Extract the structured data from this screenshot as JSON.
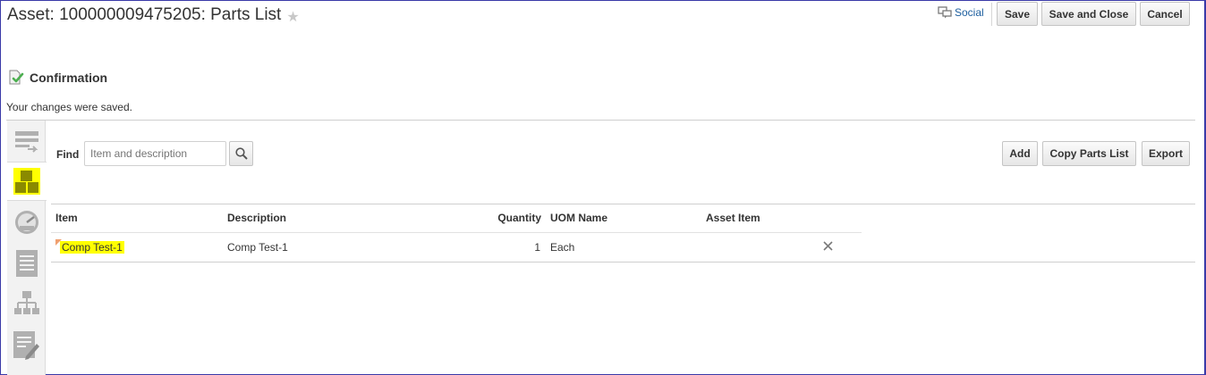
{
  "header": {
    "title": "Asset: 100000009475205:  Parts List",
    "social_label": "Social",
    "save_label": "Save",
    "save_close_label": "Save and Close",
    "cancel_label": "Cancel"
  },
  "confirmation": {
    "title": "Confirmation",
    "message": "Your changes were saved."
  },
  "sidebar": {
    "items": [
      {
        "icon": "asset-details-icon"
      },
      {
        "icon": "parts-list-icon",
        "active": true
      },
      {
        "icon": "meter-icon"
      },
      {
        "icon": "document-list-icon"
      },
      {
        "icon": "hierarchy-icon"
      },
      {
        "icon": "notes-edit-icon"
      }
    ]
  },
  "toolbar": {
    "find_label": "Find",
    "find_placeholder": "Item and description",
    "add_label": "Add",
    "copy_label": "Copy Parts List",
    "export_label": "Export"
  },
  "table": {
    "columns": [
      "Item",
      "Description",
      "Quantity",
      "UOM Name",
      "Asset Item"
    ],
    "rows": [
      {
        "item": "Comp Test-1",
        "description": "Comp Test-1",
        "quantity": "1",
        "uom": "Each",
        "asset_item": ""
      }
    ]
  },
  "colors": {
    "highlight": "#ffff00",
    "link": "#1c5e9e",
    "accent_green": "#4caf50"
  }
}
